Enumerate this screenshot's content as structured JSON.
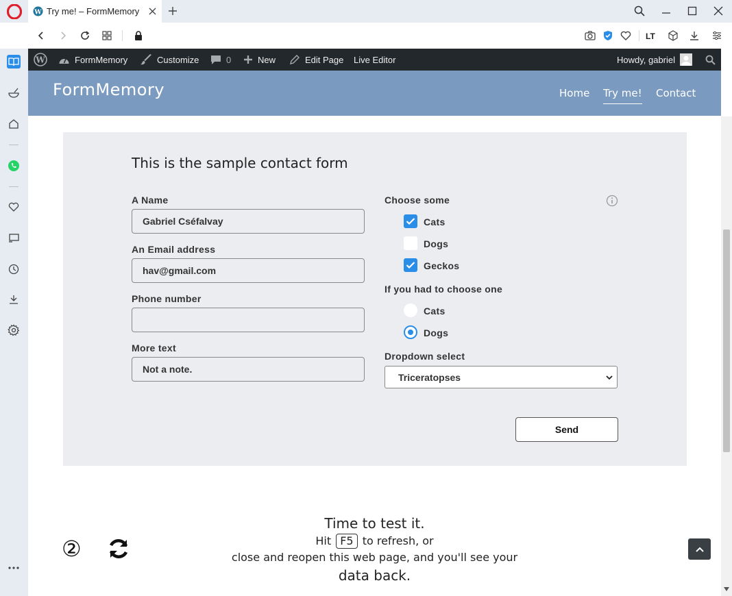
{
  "browser": {
    "tab_title": "Try me! – FormMemory",
    "icons": [
      "opera-logo",
      "wordpress-favicon",
      "close-icon",
      "plus-icon",
      "search-icon",
      "minimize-icon",
      "maximize-icon",
      "close-window-icon",
      "back-icon",
      "forward-icon",
      "reload-icon",
      "tab-grid-icon",
      "lock-icon",
      "camera-icon",
      "shield-icon",
      "heart-icon",
      "extension-icon",
      "cube-icon",
      "download-icon",
      "menu-icon"
    ]
  },
  "sidebar": {
    "icons": [
      "book-icon",
      "bowl-icon",
      "home-icon",
      "whatsapp-icon",
      "heart-icon",
      "screen-icon",
      "clock-icon",
      "download-icon",
      "gear-icon",
      "more-icon"
    ]
  },
  "wp_admin_bar": {
    "site_name": "FormMemory",
    "customize": "Customize",
    "comments_count": "0",
    "new": "New",
    "edit_page": "Edit Page",
    "live_editor": "Live Editor",
    "howdy": "Howdy, gabriel"
  },
  "site": {
    "title": "FormMemory",
    "nav": [
      "Home",
      "Try me!",
      "Contact"
    ]
  },
  "form": {
    "title": "This is the sample contact form",
    "name_label": "A Name",
    "name_value": "Gabriel Cséfalvay",
    "email_label": "An Email address",
    "email_value": "hav@gmail.com",
    "phone_label": "Phone number",
    "phone_value": "",
    "more_label": "More text",
    "more_value": "Not a note.",
    "choose_some_label": "Choose some",
    "checkboxes": [
      {
        "label": "Cats",
        "checked": true
      },
      {
        "label": "Dogs",
        "checked": false
      },
      {
        "label": "Geckos",
        "checked": true
      }
    ],
    "choose_one_label": "If you had to choose one",
    "radios": [
      {
        "label": "Cats",
        "selected": false
      },
      {
        "label": "Dogs",
        "selected": true
      }
    ],
    "dropdown_label": "Dropdown select",
    "dropdown_value": "Triceratopses",
    "send_label": "Send"
  },
  "test": {
    "title": "Time to test it.",
    "hit": "Hit",
    "key": "F5",
    "refresh": "to refresh, or",
    "line2": "close and reopen this web page, and you'll see your",
    "line3": "data back.",
    "step": "②"
  },
  "colors": {
    "accent": "#2a8ee8",
    "header_bg": "#7b9abf",
    "wpbar_bg": "#23282d",
    "form_bg": "#ecedf1"
  }
}
